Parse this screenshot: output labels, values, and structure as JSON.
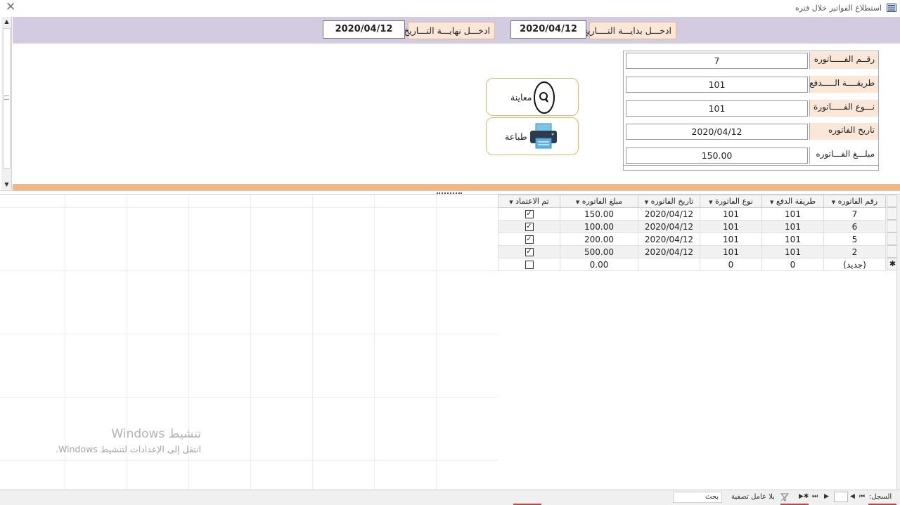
{
  "window": {
    "title": "استطلاع الفواتير خلال فتره",
    "icon": "form-icon",
    "close_glyph": "✕"
  },
  "header": {
    "start_label": "ادخـــل بدايـــة التــــاريخ",
    "start_value": "2020/04/12",
    "end_label": "ادخـــل نهايـــة التـــاريخ",
    "end_value": "2020/04/12"
  },
  "details": {
    "fields": [
      {
        "label": "رقــم الفـــــاتوره",
        "value": "7"
      },
      {
        "label": "طريقــــة الـــــدفع",
        "value": "101"
      },
      {
        "label": "نـــوع الفـــــاتورة",
        "value": "101"
      },
      {
        "label": "تاريخ الفاتوره",
        "value": "2020/04/12"
      },
      {
        "label": "مبلـــغ الفـــاتوره",
        "value": "150.00"
      }
    ]
  },
  "buttons": {
    "preview_label": "معاينة",
    "print_label": "طباعة"
  },
  "datasheet": {
    "columns": [
      "رقم الفاتوره",
      "طريقة الدفع",
      "نوع الفاتورة",
      "تاريخ الفاتوره",
      "مبلغ الفاتوره",
      "تم الاعتماد"
    ],
    "rows": [
      {
        "invoice_no": "7",
        "payment": "101",
        "type": "101",
        "date": "2020/04/12",
        "amount": "150.00",
        "approved": true
      },
      {
        "invoice_no": "6",
        "payment": "101",
        "type": "101",
        "date": "2020/04/12",
        "amount": "100.00",
        "approved": true
      },
      {
        "invoice_no": "5",
        "payment": "101",
        "type": "101",
        "date": "2020/04/12",
        "amount": "200.00",
        "approved": true
      },
      {
        "invoice_no": "2",
        "payment": "101",
        "type": "101",
        "date": "2020/04/12",
        "amount": "500.00",
        "approved": true
      }
    ],
    "new_row": {
      "invoice_no": "(جديد)",
      "payment": "0",
      "type": "0",
      "date": "",
      "amount": "0.00",
      "approved": false
    },
    "new_row_marker": "✱"
  },
  "watermark": {
    "line1": "تنشيط Windows",
    "line2": "انتقل إلى الإعدادات لتنشيط Windows."
  },
  "navbar": {
    "record_label": "السجل:",
    "no_filter_label": "بلا عامل تصفية",
    "search_label": "بحث",
    "first_glyph": "⏮",
    "prev_glyph": "◀",
    "next_glyph": "▶",
    "last_glyph": "⏭",
    "new_glyph": "▶✱"
  },
  "colors": {
    "header_band": "#d3cbe0",
    "accent_bar": "#f0b886",
    "label_fill": "#fbe7d7",
    "button_border": "#e0b86a"
  }
}
